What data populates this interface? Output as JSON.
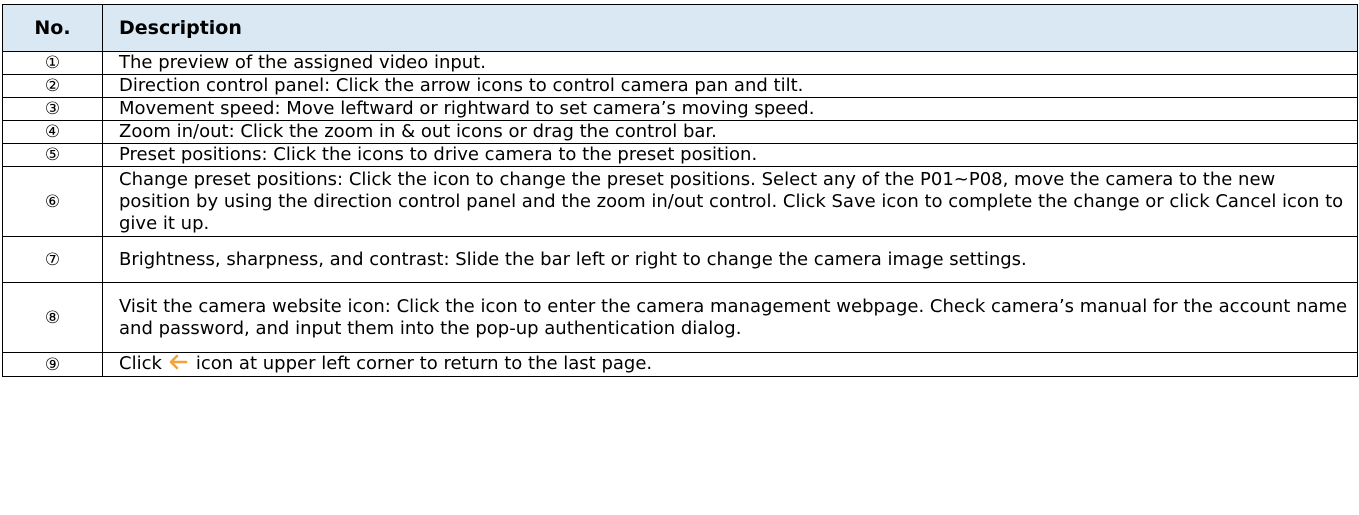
{
  "table": {
    "headers": {
      "no": "No.",
      "description": "Description"
    },
    "rows": [
      {
        "no": "①",
        "description": "The preview of the assigned video input."
      },
      {
        "no": "②",
        "description": "Direction control panel: Click the arrow icons to control camera pan and tilt."
      },
      {
        "no": "③",
        "description": "Movement speed: Move leftward or rightward to set camera’s moving speed."
      },
      {
        "no": "④",
        "description": "Zoom in/out: Click the zoom in & out icons or drag the control bar."
      },
      {
        "no": "⑤",
        "description": "Preset positions: Click the icons to drive camera to the preset position."
      },
      {
        "no": "⑥",
        "description": "Change preset positions: Click the icon to change the preset positions. Select any of the P01~P08, move the camera to the new position by using the direction control panel and the zoom in/out control. Click Save icon to complete the change or click Cancel icon to give it up."
      },
      {
        "no": "⑦",
        "description": "Brightness, sharpness, and contrast: Slide the bar left or right to change the camera image settings."
      },
      {
        "no": "⑧",
        "description": "Visit the camera website icon: Click the icon to enter the camera management webpage. Check camera’s manual for the account name and password, and input them into the pop-up authentication dialog."
      },
      {
        "no": "⑨",
        "description_before": "Click",
        "icon": "left-arrow-icon",
        "description_after": "icon at upper left corner to return to the last page."
      }
    ]
  },
  "colors": {
    "header_background": "#dae8f3",
    "border": "#000000",
    "arrow_icon": "#f2a33a"
  }
}
